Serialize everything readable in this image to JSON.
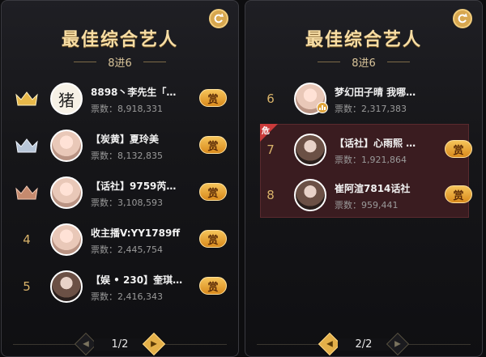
{
  "panels": [
    {
      "title": "最佳综合艺人",
      "subtitle": "8进6",
      "page": "1/2",
      "rows": [
        {
          "rank": "",
          "crown": "gold",
          "name": "8898丶李先生「…",
          "votes": "票数：8,918,331",
          "gift": "赏",
          "avatar": "calligraphy",
          "avatar_char": "猪"
        },
        {
          "rank": "",
          "crown": "silver",
          "name": "【炭黄】夏玲美",
          "votes": "票数：8,132,835",
          "gift": "赏",
          "avatar": "light"
        },
        {
          "rank": "",
          "crown": "bronze",
          "name": "【话社】9759芮…",
          "votes": "票数：3,108,593",
          "gift": "赏",
          "avatar": "light"
        },
        {
          "rank": "4",
          "crown": "",
          "name": "收主播V:YY1789ff",
          "votes": "票数：2,445,754",
          "gift": "赏",
          "avatar": "light"
        },
        {
          "rank": "5",
          "crown": "",
          "name": "【娱 • 230】奎琪…",
          "votes": "票数：2,416,343",
          "gift": "赏",
          "avatar": "dark"
        }
      ]
    },
    {
      "title": "最佳综合艺人",
      "subtitle": "8进6",
      "page": "2/2",
      "danger_tag": "危",
      "rows": [
        {
          "rank": "6",
          "name": "梦幻田子晴 我哪…",
          "votes": "票数：2,317,383",
          "gift": "",
          "avatar": "light",
          "live": true
        },
        {
          "rank": "7",
          "name": "【话社】心雨熙 …",
          "votes": "票数：1,921,864",
          "gift": "赏",
          "avatar": "dark",
          "danger": true
        },
        {
          "rank": "8",
          "name": "崔阿渲7814话社",
          "votes": "票数：959,441",
          "gift": "赏",
          "avatar": "dark",
          "danger": true
        }
      ]
    }
  ],
  "colors": {
    "gold": "#e7b84a",
    "silver": "#b8c6d8",
    "bronze": "#c58a6e",
    "accent": "#d7a74f",
    "danger": "#c93a3a"
  },
  "icons": {
    "refresh": "refresh-icon",
    "crown": "crown-icon",
    "prev": "chevron-left-icon",
    "next": "chevron-right-icon"
  }
}
